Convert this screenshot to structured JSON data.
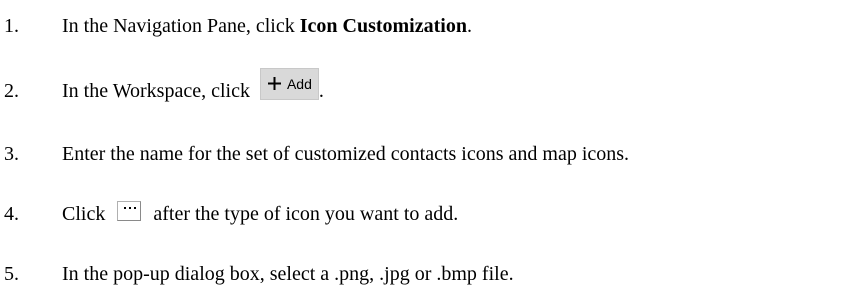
{
  "steps": [
    {
      "number": "1.",
      "before": "In the Navigation Pane, click ",
      "bold": "Icon Customization",
      "after": "."
    },
    {
      "number": "2.",
      "before": "In the Workspace, click",
      "button_label": "Add",
      "after": "."
    },
    {
      "number": "3.",
      "text": "Enter the name for the set of customized contacts icons and map icons."
    },
    {
      "number": "4.",
      "before": "Click",
      "after": "after the type of icon you want to add."
    },
    {
      "number": "5.",
      "text": "In the pop-up dialog box, select a .png, .jpg or .bmp file."
    }
  ]
}
